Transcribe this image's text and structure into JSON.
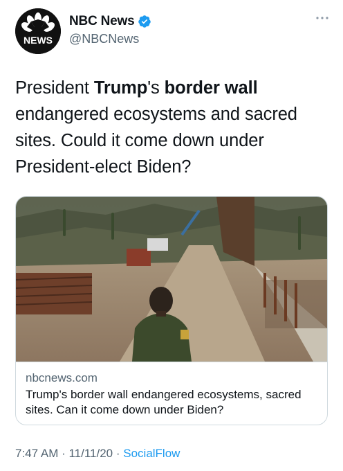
{
  "account": {
    "display_name": "NBC News",
    "handle": "@NBCNews",
    "logo_text": "NEWS",
    "verified_icon": "verified-badge-icon",
    "more_icon": "more-options-icon"
  },
  "tweet": {
    "text_parts": [
      "President ",
      "Trump",
      "'s ",
      "border wall",
      " endangered ecosystems and sacred sites. Could it come down under President-elect Biden?"
    ]
  },
  "card": {
    "domain": "nbcnews.com",
    "title": "Trump's border wall endangered ecosystems, sacred sites. Can it come down under Biden?"
  },
  "meta": {
    "time": "7:47 AM",
    "separator": " · ",
    "date": "11/11/20",
    "source": "SocialFlow"
  },
  "colors": {
    "link": "#1d9bf0",
    "secondary_text": "#536471",
    "verified": "#1d9bf0"
  }
}
